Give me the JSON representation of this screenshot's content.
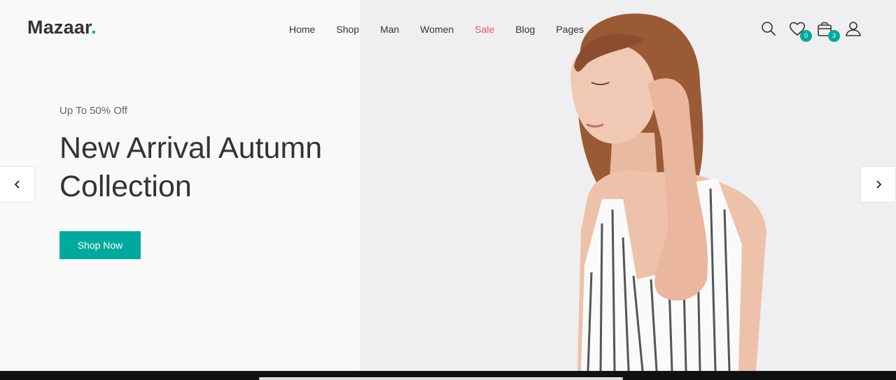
{
  "brand": {
    "name": "Mazaar",
    "dot": ".",
    "accent": "#00a99d"
  },
  "nav": {
    "items": [
      {
        "label": "Home"
      },
      {
        "label": "Shop"
      },
      {
        "label": "Man"
      },
      {
        "label": "Women"
      },
      {
        "label": "Sale",
        "color": "#e8575f"
      },
      {
        "label": "Blog"
      },
      {
        "label": "Pages"
      }
    ]
  },
  "header_icons": {
    "search": "search-icon",
    "wishlist": {
      "icon": "heart-icon",
      "count": "0"
    },
    "cart": {
      "icon": "bag-icon",
      "count": "3"
    },
    "account": "user-icon"
  },
  "hero": {
    "pretitle": "Up To 50% Off",
    "title_line1": "New Arrival Autumn",
    "title_line2": "Collection",
    "cta": "Shop Now"
  },
  "slider": {
    "prev": "chevron-left-icon",
    "next": "chevron-right-icon"
  }
}
